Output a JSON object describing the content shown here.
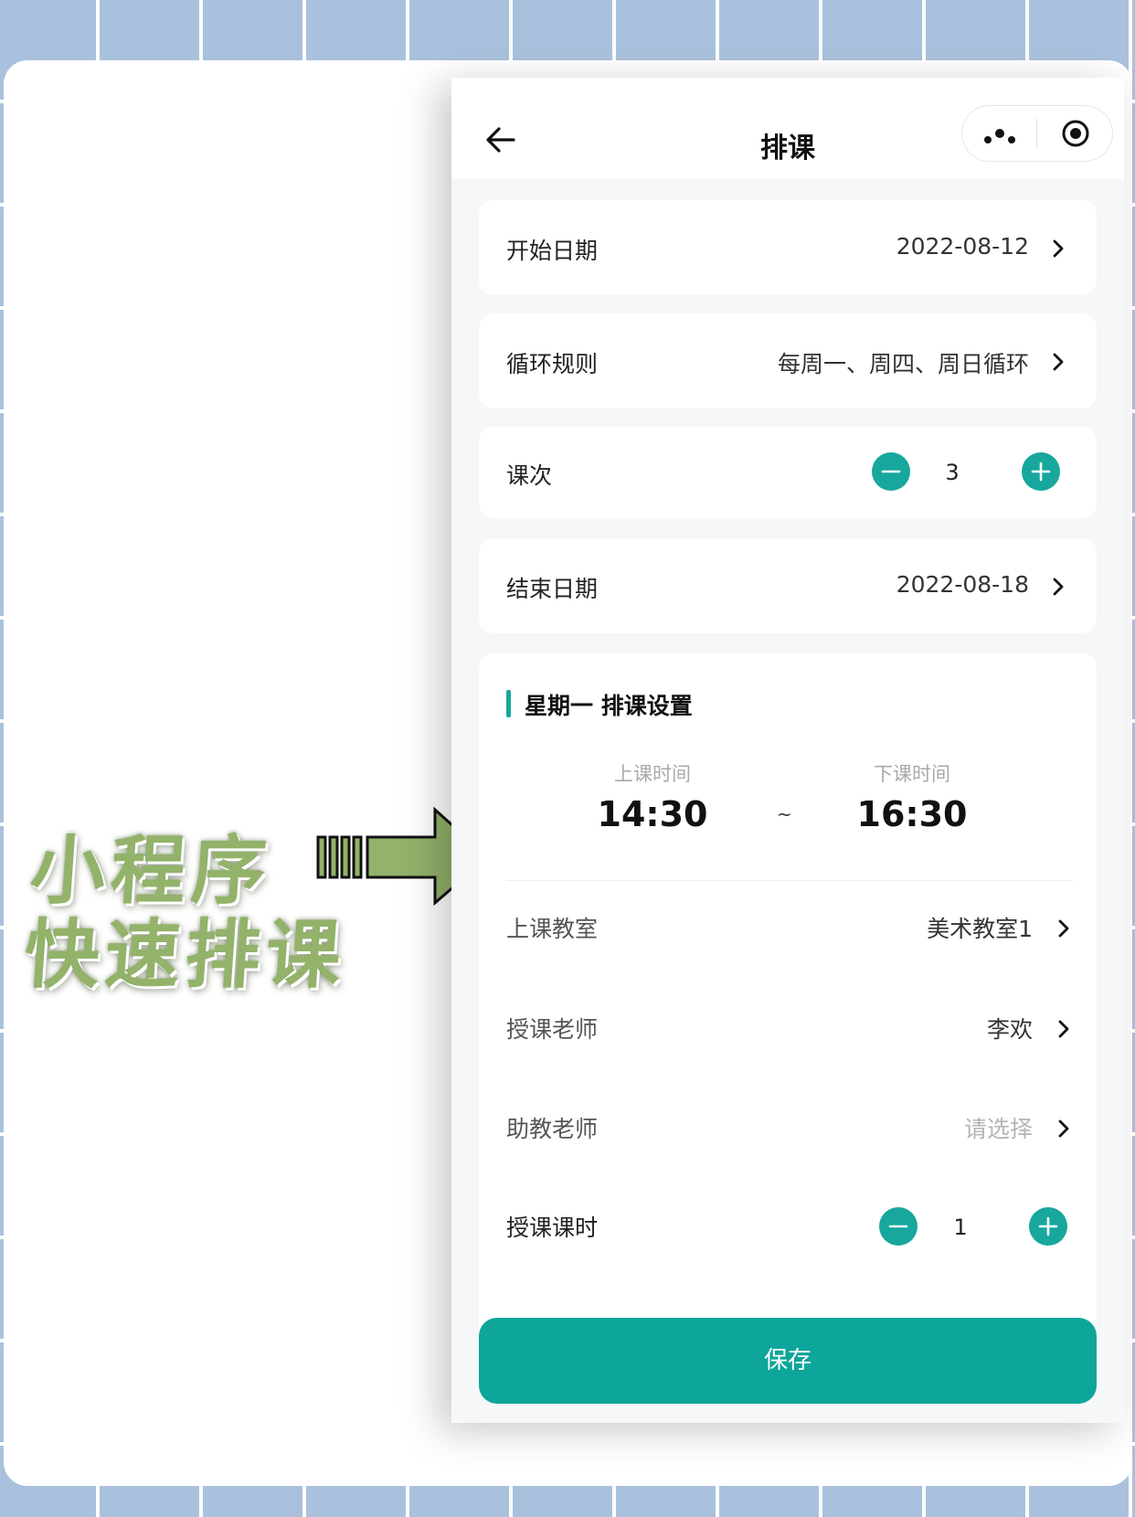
{
  "promo": {
    "line1": "小程序",
    "line2": "快速排课"
  },
  "navbar": {
    "title": "排课"
  },
  "form": {
    "start_date": {
      "label": "开始日期",
      "value": "2022-08-12"
    },
    "repeat_rule": {
      "label": "循环规则",
      "value": "每周一、周四、周日循环"
    },
    "sessions": {
      "label": "课次",
      "value": "3"
    },
    "end_date": {
      "label": "结束日期",
      "value": "2022-08-18"
    }
  },
  "schedule": {
    "title": "星期一 排课设置",
    "start_time": {
      "caption": "上课时间",
      "value": "14:30"
    },
    "separator": "~",
    "end_time": {
      "caption": "下课时间",
      "value": "16:30"
    },
    "classroom": {
      "label": "上课教室",
      "value": "美术教室1"
    },
    "teacher": {
      "label": "授课老师",
      "value": "李欢"
    },
    "assistant": {
      "label": "助教老师",
      "placeholder": "请选择"
    },
    "hours": {
      "label": "授课课时",
      "value": "1"
    }
  },
  "save_label": "保存",
  "colors": {
    "accent": "#17a79d",
    "promo_text": "#93b26a",
    "background_grid": "#a9c1dc"
  }
}
